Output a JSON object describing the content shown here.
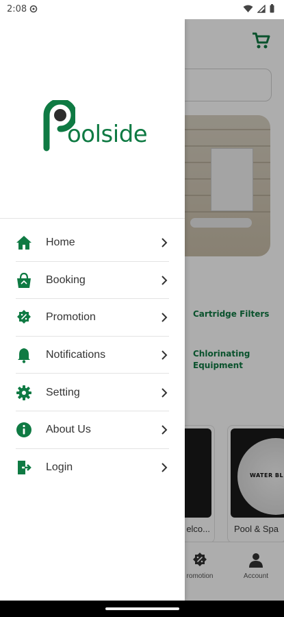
{
  "status": {
    "time": "2:08",
    "icons": [
      "settings-gear-icon",
      "wifi-icon",
      "signal-icon",
      "battery-icon"
    ]
  },
  "drawer": {
    "logo_text": "oolside",
    "logo_initial": "P",
    "menu": [
      {
        "label": "Home",
        "icon": "home-icon"
      },
      {
        "label": "Booking",
        "icon": "shopping-bag-icon"
      },
      {
        "label": "Promotion",
        "icon": "discount-badge-icon"
      },
      {
        "label": "Notifications",
        "icon": "bell-icon"
      },
      {
        "label": "Setting",
        "icon": "gear-icon"
      },
      {
        "label": "About Us",
        "icon": "info-icon"
      },
      {
        "label": "Login",
        "icon": "login-icon"
      }
    ]
  },
  "background": {
    "categories": [
      "Cartridge Filters",
      "Chlorinating Equipment"
    ],
    "products": [
      {
        "label": "elco..."
      },
      {
        "label": "Pool & Spa",
        "badge_text": "WATER BL"
      }
    ],
    "bottom_nav": [
      {
        "label": "romotion",
        "icon": "discount-badge-icon"
      },
      {
        "label": "Account",
        "icon": "person-icon"
      }
    ]
  },
  "colors": {
    "brand": "#0f7a43",
    "scrim": "rgba(0,0,0,0.32)"
  }
}
